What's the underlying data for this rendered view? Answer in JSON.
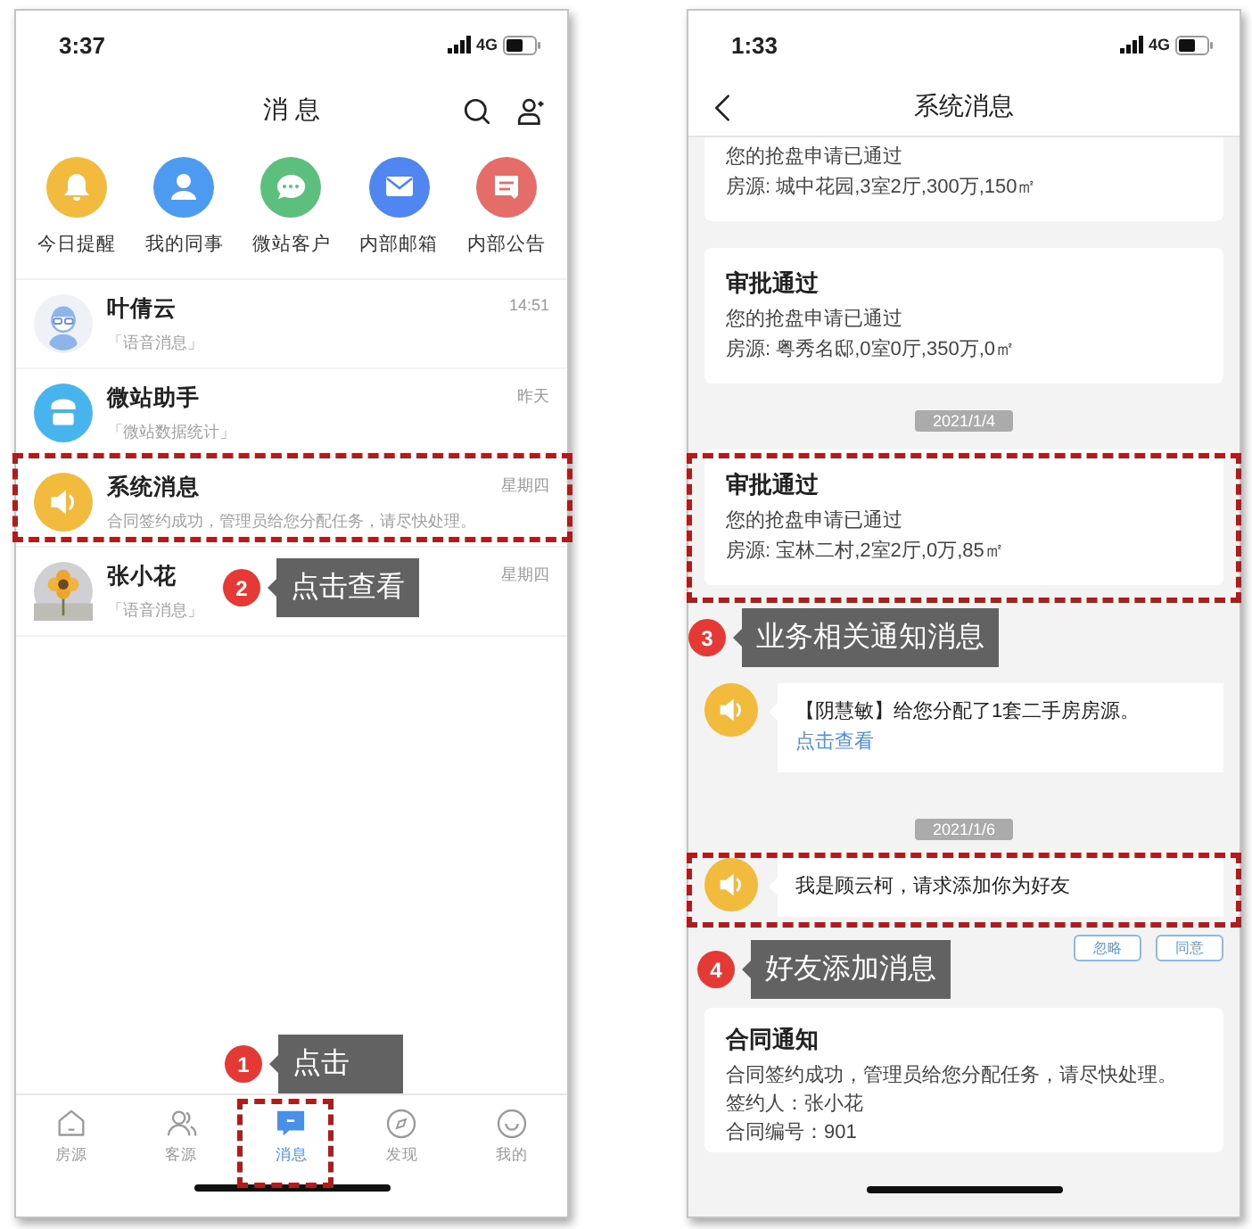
{
  "left_phone": {
    "status_time": "3:37",
    "network": "4G",
    "title": "消 息",
    "shortcuts": [
      {
        "label": "今日提醒",
        "color": "#f2bb3e"
      },
      {
        "label": "我的同事",
        "color": "#4c9bf0"
      },
      {
        "label": "微站客户",
        "color": "#5cbf7d"
      },
      {
        "label": "内部邮箱",
        "color": "#4f86ef"
      },
      {
        "label": "内部公告",
        "color": "#e46d6a"
      }
    ],
    "conversations": [
      {
        "name": "叶倩云",
        "time": "14:51",
        "preview": "「语音消息」"
      },
      {
        "name": "微站助手",
        "time": "昨天",
        "preview": "「微站数据统计」"
      },
      {
        "name": "系统消息",
        "time": "星期四",
        "preview": "合同签约成功，管理员给您分配任务，请尽快处理。"
      },
      {
        "name": "张小花",
        "time": "星期四",
        "preview": "「语音消息」"
      }
    ],
    "tabs": [
      {
        "label": "房源",
        "selected": false
      },
      {
        "label": "客源",
        "selected": false
      },
      {
        "label": "消息",
        "selected": true
      },
      {
        "label": "发现",
        "selected": false
      },
      {
        "label": "我的",
        "selected": false
      }
    ]
  },
  "right_phone": {
    "status_time": "1:33",
    "network": "4G",
    "title": "系统消息",
    "feed": [
      {
        "kind": "card",
        "lines": [
          "您的抢盘申请已通过",
          "房源: 城中花园,3室2厅,300万,150㎡"
        ]
      },
      {
        "kind": "card",
        "title": "审批通过",
        "lines": [
          "您的抢盘申请已通过",
          "房源: 粤秀名邸,0室0厅,350万,0㎡"
        ]
      },
      {
        "kind": "date",
        "text": "2021/1/4"
      },
      {
        "kind": "card",
        "title": "审批通过",
        "lines": [
          "您的抢盘申请已通过",
          "房源: 宝林二村,2室2厅,0万,85㎡"
        ]
      },
      {
        "kind": "notice",
        "text": "【阴慧敏】给您分配了1套二手房房源。",
        "link": "点击查看"
      },
      {
        "kind": "date",
        "text": "2021/1/6"
      },
      {
        "kind": "notice",
        "text": "我是顾云柯，请求添加你为好友"
      },
      {
        "kind": "actions",
        "buttons": [
          "忽略",
          "同意"
        ]
      },
      {
        "kind": "card",
        "title": "合同通知",
        "lines": [
          "合同签约成功，管理员给您分配任务，请尽快处理。",
          "签约人：张小花",
          "合同编号：901"
        ]
      }
    ]
  },
  "annotations": [
    {
      "number": "2",
      "text": "点击查看"
    },
    {
      "number": "1",
      "text": "点击"
    },
    {
      "number": "3",
      "text": "业务相关通知消息"
    },
    {
      "number": "4",
      "text": "好友添加消息"
    }
  ]
}
